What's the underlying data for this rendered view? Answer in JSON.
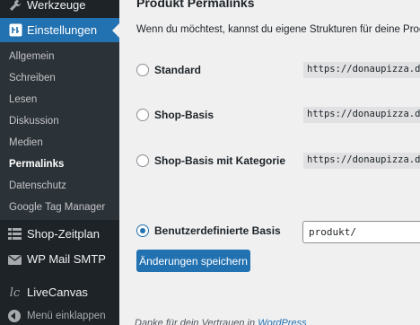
{
  "sidebar": {
    "top_item": {
      "label": "Werkzeuge",
      "icon": "wrench-icon"
    },
    "active_item": {
      "label": "Einstellungen",
      "icon": "settings-icon"
    },
    "submenu": [
      {
        "label": "Allgemein"
      },
      {
        "label": "Schreiben"
      },
      {
        "label": "Lesen"
      },
      {
        "label": "Diskussion"
      },
      {
        "label": "Medien"
      },
      {
        "label": "Permalinks",
        "current": true
      },
      {
        "label": "Datenschutz"
      },
      {
        "label": "Google Tag Manager"
      }
    ],
    "items": [
      {
        "label": "Shop-Zeitplan",
        "icon": "calendar-grid-icon"
      },
      {
        "label": "WP Mail SMTP",
        "icon": "mail-icon"
      },
      {
        "label": "LiveCanvas",
        "icon": "livecanvas-icon"
      }
    ],
    "collapse_label": "Menü einklappen"
  },
  "main": {
    "section_title": "Produkt Permalinks",
    "description": "Wenn du möchtest, kannst du eigene Strukturen für deine Produkt",
    "options": [
      {
        "label": "Standard",
        "code": "https://donaupizza.de/",
        "checked": false
      },
      {
        "label": "Shop-Basis",
        "code": "https://donaupizza.de/",
        "checked": false
      },
      {
        "label": "Shop-Basis mit Kategorie",
        "code": "https://donaupizza.de/",
        "checked": false
      },
      {
        "label": "Benutzerdefinierte Basis",
        "checked": true
      }
    ],
    "custom_base_value": "produkt/",
    "save_label": "Änderungen speichern",
    "footer_text": "Danke für dein Vertrauen in ",
    "footer_link": "WordPress"
  },
  "colors": {
    "sidebar_bg": "#1d2327",
    "submenu_bg": "#2c3338",
    "accent": "#2271b1",
    "page_bg": "#f0f0f1"
  }
}
